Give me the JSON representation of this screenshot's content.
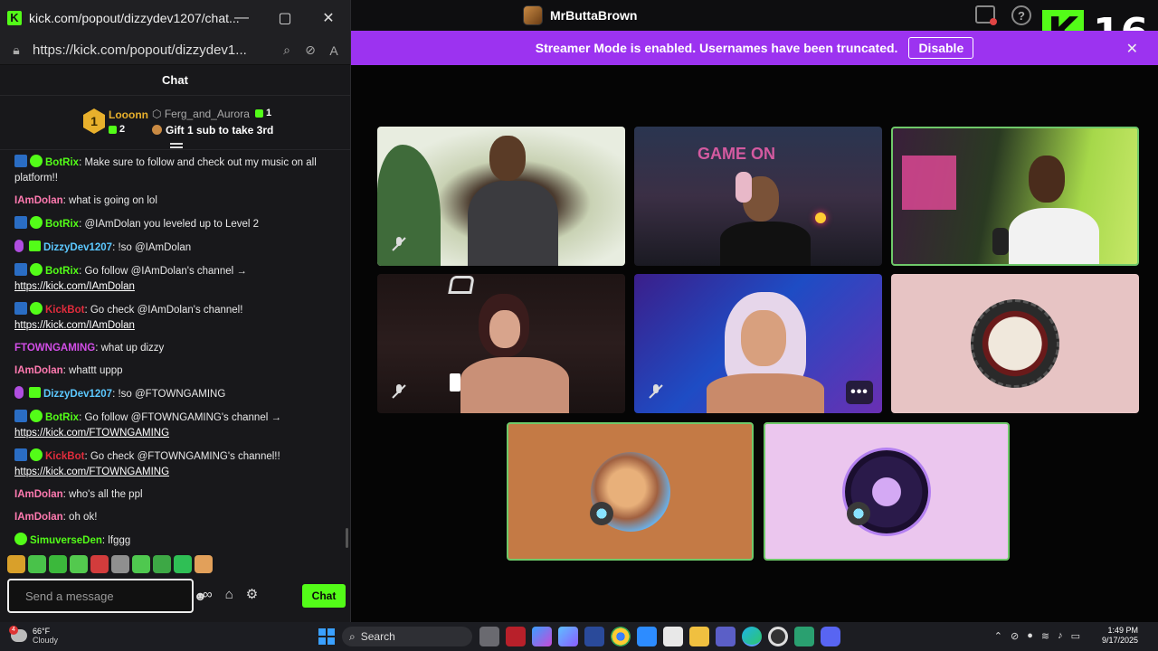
{
  "popout_window": {
    "title": "kick.com/popout/dizzydev1207/chat...",
    "url": "https://kick.com/popout/dizzydev1...",
    "controls": {
      "minimize": "—",
      "maximize": "▢",
      "close": "✕"
    }
  },
  "chat": {
    "header": "Chat",
    "leaderboard": {
      "first": {
        "rank": "1",
        "name": "Looonn",
        "subs": "2"
      },
      "second": {
        "name": "Ferg_and_Aurora",
        "subs": "1"
      },
      "third_prompt": "Gift 1 sub to take 3rd"
    },
    "messages": [
      {
        "badges": [
          "pin",
          "verified"
        ],
        "user": "BotRix",
        "user_color": "#53fc18",
        "segments": [
          {
            "type": "text",
            "text": ": Make sure to follow and check out my music on all platform!!"
          }
        ]
      },
      {
        "badges": [],
        "user": "IAmDolan",
        "user_color": "#ff7ab0",
        "segments": [
          {
            "type": "text",
            "text": ": what is going on lol"
          }
        ]
      },
      {
        "badges": [
          "pin",
          "verified"
        ],
        "user": "BotRix",
        "user_color": "#53fc18",
        "segments": [
          {
            "type": "text",
            "text": ": @IAmDolan you leveled up to Level 2"
          }
        ]
      },
      {
        "badges": [
          "mic",
          "sub"
        ],
        "user": "DizzyDev1207",
        "user_color": "#5cc8ff",
        "segments": [
          {
            "type": "text",
            "text": ": !so @IAmDolan"
          }
        ]
      },
      {
        "badges": [
          "pin",
          "verified"
        ],
        "user": "BotRix",
        "user_color": "#53fc18",
        "segments": [
          {
            "type": "text",
            "text": ": Go follow @IAmDolan's channel → "
          },
          {
            "type": "link",
            "text": "https://kick.com/IAmDolan"
          }
        ]
      },
      {
        "badges": [
          "pin",
          "verified"
        ],
        "user": "KickBot",
        "user_color": "#e02c3c",
        "segments": [
          {
            "type": "text",
            "text": ": Go check @IAmDolan's channel! "
          },
          {
            "type": "link",
            "text": "https://kick.com/IAmDolan"
          }
        ]
      },
      {
        "badges": [],
        "user": "FTOWNGAMING",
        "user_color": "#d34ee8",
        "segments": [
          {
            "type": "text",
            "text": ": what up dizzy"
          }
        ]
      },
      {
        "badges": [],
        "user": "IAmDolan",
        "user_color": "#ff7ab0",
        "segments": [
          {
            "type": "text",
            "text": ": whattt uppp"
          }
        ]
      },
      {
        "badges": [
          "mic",
          "sub"
        ],
        "user": "DizzyDev1207",
        "user_color": "#5cc8ff",
        "segments": [
          {
            "type": "text",
            "text": ": !so @FTOWNGAMING"
          }
        ]
      },
      {
        "badges": [
          "pin",
          "verified"
        ],
        "user": "BotRix",
        "user_color": "#53fc18",
        "segments": [
          {
            "type": "text",
            "text": ": Go follow @FTOWNGAMING's channel → "
          },
          {
            "type": "link",
            "text": "https://kick.com/FTOWNGAMING"
          }
        ]
      },
      {
        "badges": [
          "pin",
          "verified"
        ],
        "user": "KickBot",
        "user_color": "#e02c3c",
        "segments": [
          {
            "type": "text",
            "text": ": Go check @FTOWNGAMING's channel!! "
          },
          {
            "type": "link",
            "text": "https://kick.com/FTOWNGAMING"
          }
        ]
      },
      {
        "badges": [],
        "user": "IAmDolan",
        "user_color": "#ff7ab0",
        "segments": [
          {
            "type": "text",
            "text": ": who's all the ppl"
          }
        ]
      },
      {
        "badges": [],
        "user": "IAmDolan",
        "user_color": "#ff7ab0",
        "segments": [
          {
            "type": "text",
            "text": ": oh ok!"
          }
        ]
      },
      {
        "badges": [
          "verified"
        ],
        "user": "SimuverseDen",
        "user_color": "#53fc18",
        "segments": [
          {
            "type": "text",
            "text": ": lfggg"
          }
        ]
      }
    ],
    "composer": {
      "placeholder": "Send a message",
      "send_label": "Chat"
    },
    "emote_colors": [
      "#d9a02a",
      "#49c24a",
      "#3bb83b",
      "#53c94e",
      "#d23c3c",
      "#8f8f8f",
      "#4fc84f",
      "#3da845",
      "#2fbf55",
      "#e2a05a"
    ]
  },
  "call": {
    "host_name": "MrButtaBrown",
    "banner": {
      "text": "Streamer Mode is enabled. Usernames have been truncated.",
      "button": "Disable"
    },
    "kick_logo": "K",
    "kick_count": "16",
    "help_glyph": "?"
  },
  "taskbar": {
    "weather": {
      "temp": "66°F",
      "condition": "Cloudy",
      "badge": "4"
    },
    "search_label": "Search",
    "clock": {
      "time": "1:49 PM",
      "date": "9/17/2025"
    }
  }
}
